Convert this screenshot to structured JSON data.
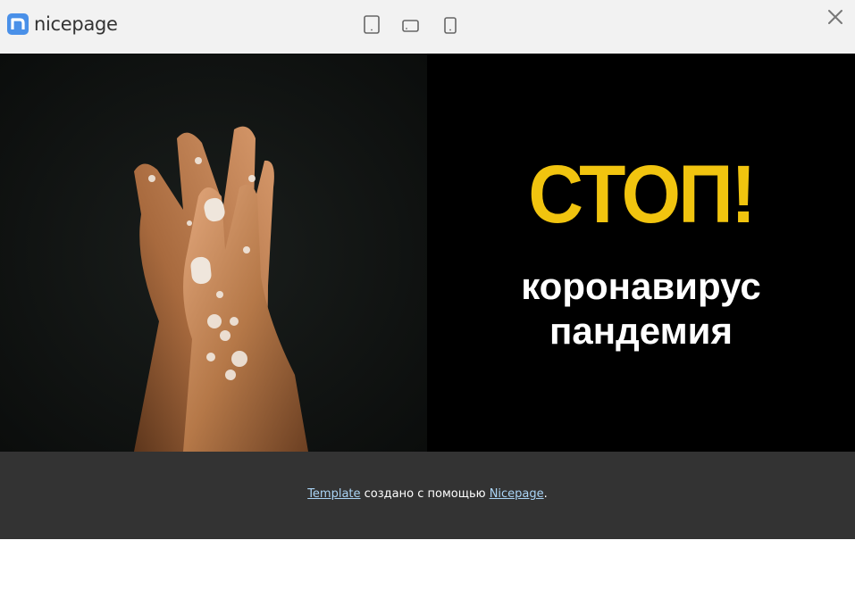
{
  "toolbar": {
    "logo_text": "nicepage",
    "devices": [
      "desktop",
      "tablet",
      "phone"
    ]
  },
  "hero": {
    "headline": "СТОП!",
    "subtitle_line1": "коронавирус",
    "subtitle_line2": "пандемия",
    "colors": {
      "headline": "#f1c40f",
      "subtitle": "#ffffff",
      "panel_bg": "#000000"
    }
  },
  "footer": {
    "link1": "Template",
    "middle": " создано с помощью ",
    "link2": "Nicepage",
    "end": ".",
    "colors": {
      "bg": "#333333",
      "link": "#aad4f5"
    }
  },
  "icons": {
    "logo": "nicepage-logo-icon",
    "desktop": "desktop-view-icon",
    "tablet": "tablet-view-icon",
    "phone": "phone-view-icon",
    "close": "close-icon"
  }
}
